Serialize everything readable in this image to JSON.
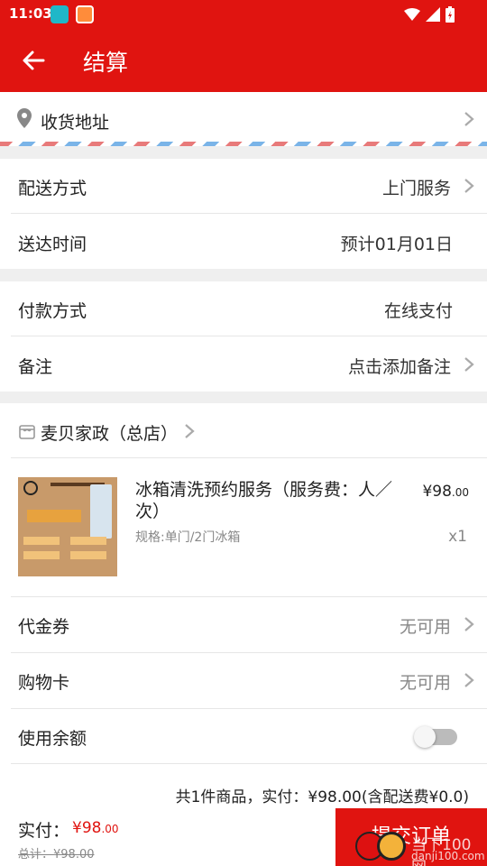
{
  "status_bar": {
    "time": "11:03"
  },
  "header": {
    "title": "结算"
  },
  "address": {
    "label": "收货地址"
  },
  "delivery": {
    "method_label": "配送方式",
    "method_value": "上门服务",
    "time_label": "送达时间",
    "time_value": "预计01月01日"
  },
  "payment": {
    "method_label": "付款方式",
    "method_value": "在线支付",
    "remark_label": "备注",
    "remark_value": "点击添加备注"
  },
  "shop": {
    "name": "麦贝家政（总店）"
  },
  "product": {
    "name": "冰箱清洗预约服务（服务费：人／次）",
    "spec": "规格:单门/2门冰箱",
    "price_main": "¥98",
    "price_decimal": ".00",
    "quantity": "x1"
  },
  "voucher": {
    "label": "代金券",
    "value": "无可用"
  },
  "shopping_card": {
    "label": "购物卡",
    "value": "无可用"
  },
  "balance": {
    "label": "使用余额",
    "enabled": false
  },
  "summary": {
    "text": "共1件商品，实付：¥98.00(含配送费¥0.0)"
  },
  "footer": {
    "pay_label": "实付：",
    "pay_main": "¥98",
    "pay_decimal": ".00",
    "total_text": "总计：¥98.00",
    "submit_label": "提交订单"
  },
  "watermark": {
    "site": "当下100网",
    "url": "danji100.com"
  },
  "colors": {
    "brand_red": "#e01410",
    "background": "#efefef"
  }
}
